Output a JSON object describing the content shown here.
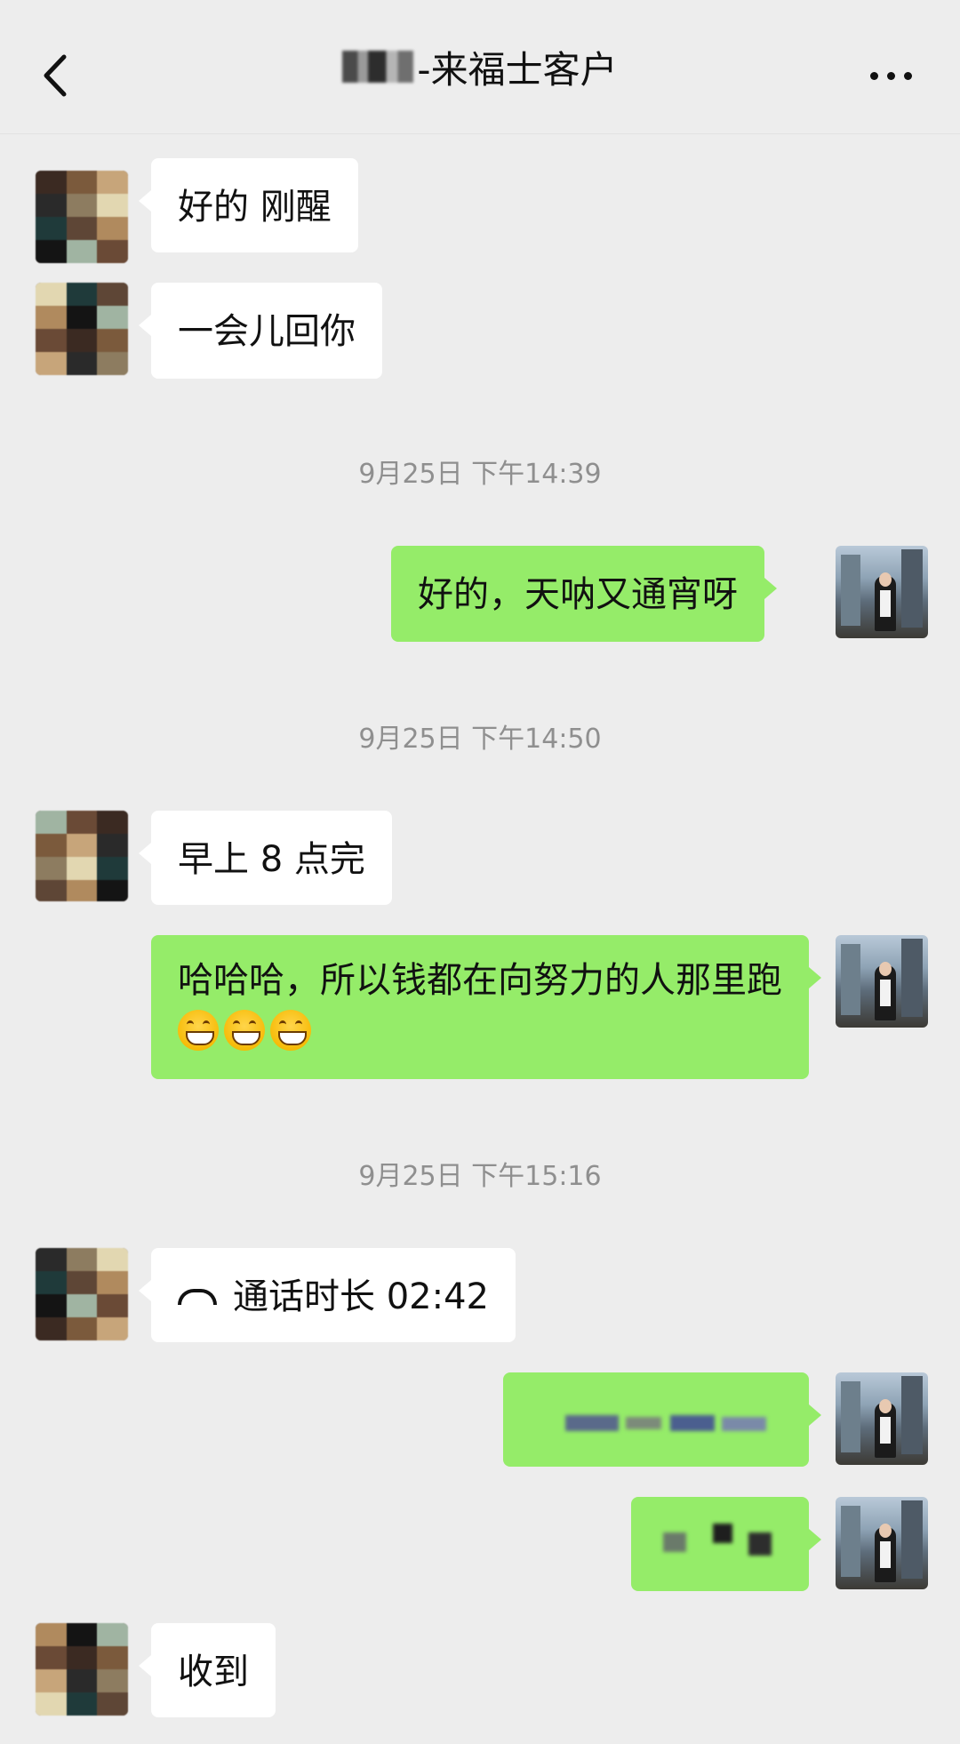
{
  "header": {
    "title": "-来福士客户",
    "back_icon": "chevron-left-icon",
    "more_icon": "more-horizontal-icon"
  },
  "messages": [
    {
      "side": "left",
      "text": "好的 刚醒"
    },
    {
      "side": "left",
      "text": "一会儿回你"
    },
    {
      "type": "timestamp",
      "text": "9月25日 下午14:39"
    },
    {
      "side": "right",
      "text": "好的，天呐又通宵呀"
    },
    {
      "type": "timestamp",
      "text": "9月25日 下午14:50"
    },
    {
      "side": "left",
      "text": "早上 8 点完"
    },
    {
      "side": "right",
      "text": "哈哈哈，所以钱都在向努力的人那里跑",
      "emoji": [
        "grin-icon",
        "grin-icon",
        "grin-icon"
      ]
    },
    {
      "type": "timestamp",
      "text": "9月25日 下午15:16"
    },
    {
      "side": "left",
      "type": "call",
      "text": "通话时长 02:42",
      "icon": "phone-hangup-icon"
    },
    {
      "side": "right",
      "redacted": true
    },
    {
      "side": "right",
      "redacted": true
    },
    {
      "side": "left",
      "text": "收到"
    }
  ],
  "colors": {
    "background": "#ededed",
    "bubble_self": "#95ec69",
    "bubble_other": "#ffffff",
    "timestamp": "#8f8f8f"
  }
}
